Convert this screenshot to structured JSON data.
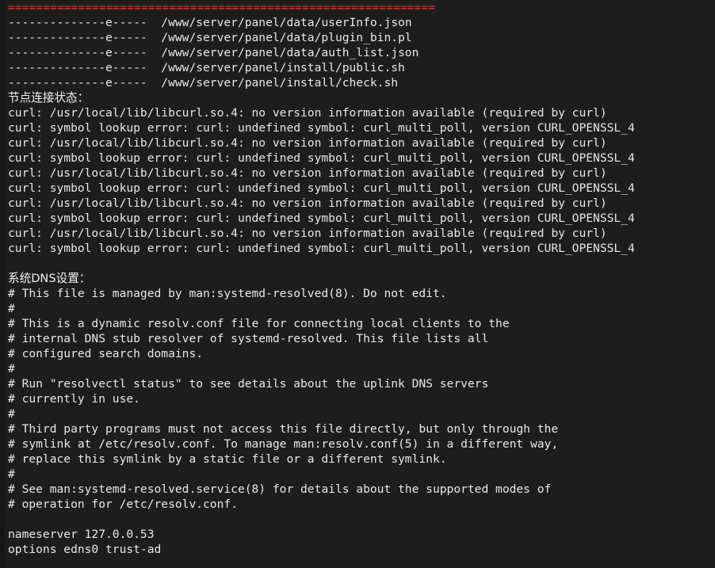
{
  "terminal": {
    "background": "#1d1d1d",
    "gutter_color": "#151515",
    "foreground": "#e8e8e8",
    "separator_color": "#e23b28",
    "lines": [
      {
        "id": "separator-top",
        "kind": "sep",
        "text": "============================================================="
      },
      {
        "id": "file-userinfo",
        "kind": "plain",
        "text": "--------------e-----  /www/server/panel/data/userInfo.json"
      },
      {
        "id": "file-plugin-bin",
        "kind": "plain",
        "text": "--------------e-----  /www/server/panel/data/plugin_bin.pl"
      },
      {
        "id": "file-auth-list",
        "kind": "plain",
        "text": "--------------e-----  /www/server/panel/data/auth_list.json"
      },
      {
        "id": "file-public-sh",
        "kind": "plain",
        "text": "--------------e-----  /www/server/panel/install/public.sh"
      },
      {
        "id": "file-check-sh",
        "kind": "plain",
        "text": "--------------e-----  /www/server/panel/install/check.sh"
      },
      {
        "id": "heading-node-status",
        "kind": "cn",
        "text": "节点连接状态："
      },
      {
        "id": "curl-noversion-1",
        "kind": "plain",
        "text": "curl: /usr/local/lib/libcurl.so.4: no version information available (required by curl)"
      },
      {
        "id": "curl-symbol-1",
        "kind": "plain",
        "text": "curl: symbol lookup error: curl: undefined symbol: curl_multi_poll, version CURL_OPENSSL_4"
      },
      {
        "id": "curl-noversion-2",
        "kind": "plain",
        "text": "curl: /usr/local/lib/libcurl.so.4: no version information available (required by curl)"
      },
      {
        "id": "curl-symbol-2",
        "kind": "plain",
        "text": "curl: symbol lookup error: curl: undefined symbol: curl_multi_poll, version CURL_OPENSSL_4"
      },
      {
        "id": "curl-noversion-3",
        "kind": "plain",
        "text": "curl: /usr/local/lib/libcurl.so.4: no version information available (required by curl)"
      },
      {
        "id": "curl-symbol-3",
        "kind": "plain",
        "text": "curl: symbol lookup error: curl: undefined symbol: curl_multi_poll, version CURL_OPENSSL_4"
      },
      {
        "id": "curl-noversion-4",
        "kind": "plain",
        "text": "curl: /usr/local/lib/libcurl.so.4: no version information available (required by curl)"
      },
      {
        "id": "curl-symbol-4",
        "kind": "plain",
        "text": "curl: symbol lookup error: curl: undefined symbol: curl_multi_poll, version CURL_OPENSSL_4"
      },
      {
        "id": "curl-noversion-5",
        "kind": "plain",
        "text": "curl: /usr/local/lib/libcurl.so.4: no version information available (required by curl)"
      },
      {
        "id": "curl-symbol-5",
        "kind": "plain",
        "text": "curl: symbol lookup error: curl: undefined symbol: curl_multi_poll, version CURL_OPENSSL_4"
      },
      {
        "id": "blank-1",
        "kind": "blank",
        "text": " "
      },
      {
        "id": "heading-dns-settings",
        "kind": "cn",
        "text": "系统DNS设置："
      },
      {
        "id": "resolv-managed-by",
        "kind": "plain",
        "text": "# This file is managed by man:systemd-resolved(8). Do not edit."
      },
      {
        "id": "resolv-hash-1",
        "kind": "plain",
        "text": "#"
      },
      {
        "id": "resolv-dynamic-1",
        "kind": "plain",
        "text": "# This is a dynamic resolv.conf file for connecting local clients to the"
      },
      {
        "id": "resolv-dynamic-2",
        "kind": "plain",
        "text": "# internal DNS stub resolver of systemd-resolved. This file lists all"
      },
      {
        "id": "resolv-dynamic-3",
        "kind": "plain",
        "text": "# configured search domains."
      },
      {
        "id": "resolv-hash-2",
        "kind": "plain",
        "text": "#"
      },
      {
        "id": "resolv-run-status-1",
        "kind": "plain",
        "text": "# Run \"resolvectl status\" to see details about the uplink DNS servers"
      },
      {
        "id": "resolv-run-status-2",
        "kind": "plain",
        "text": "# currently in use."
      },
      {
        "id": "resolv-hash-3",
        "kind": "plain",
        "text": "#"
      },
      {
        "id": "resolv-thirdparty-1",
        "kind": "plain",
        "text": "# Third party programs must not access this file directly, but only through the"
      },
      {
        "id": "resolv-thirdparty-2",
        "kind": "plain",
        "text": "# symlink at /etc/resolv.conf. To manage man:resolv.conf(5) in a different way,"
      },
      {
        "id": "resolv-thirdparty-3",
        "kind": "plain",
        "text": "# replace this symlink by a static file or a different symlink."
      },
      {
        "id": "resolv-hash-4",
        "kind": "plain",
        "text": "#"
      },
      {
        "id": "resolv-see-modes-1",
        "kind": "plain",
        "text": "# See man:systemd-resolved.service(8) for details about the supported modes of"
      },
      {
        "id": "resolv-see-modes-2",
        "kind": "plain",
        "text": "# operation for /etc/resolv.conf."
      },
      {
        "id": "blank-2",
        "kind": "blank",
        "text": " "
      },
      {
        "id": "resolv-nameserver",
        "kind": "plain",
        "text": "nameserver 127.0.0.53"
      },
      {
        "id": "resolv-options",
        "kind": "plain",
        "text": "options edns0 trust-ad"
      }
    ]
  }
}
